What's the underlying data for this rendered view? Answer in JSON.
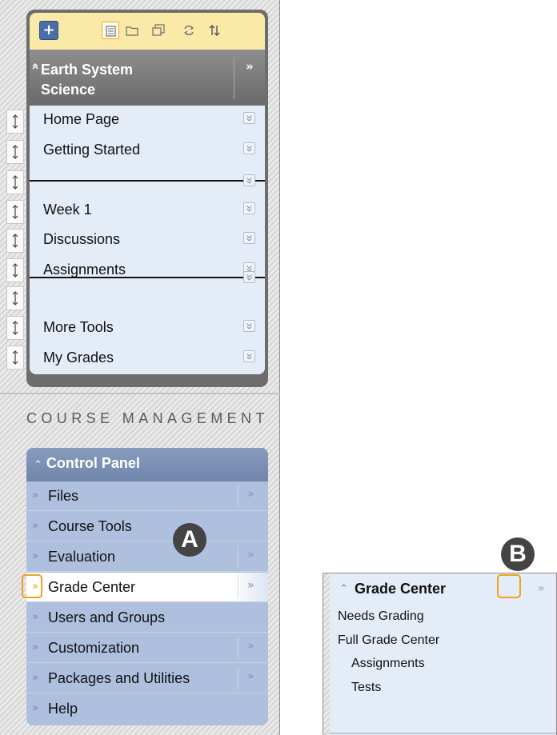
{
  "course_menu": {
    "title": "Earth System Science",
    "title_line1": "Earth System",
    "title_line2": "Science",
    "title_collapse_icon": "double-chevron-up-icon",
    "title_expand_icon": "double-chevron-right-icon",
    "toolbar_icons": [
      "plus-icon",
      "list-view-icon",
      "folder-view-icon",
      "new-window-icon",
      "refresh-icon",
      "reorder-icon"
    ],
    "items": [
      {
        "label": "Home Page"
      },
      {
        "label": "Getting Started"
      },
      {
        "label": "Week 1"
      },
      {
        "label": "Discussions"
      },
      {
        "label": "Assignments"
      },
      {
        "label": "More Tools"
      },
      {
        "label": "My Grades"
      }
    ]
  },
  "course_management": {
    "title": "COURSE MANAGEMENT",
    "control_panel": {
      "label": "Control Panel",
      "items": [
        {
          "label": "Files"
        },
        {
          "label": "Course Tools"
        },
        {
          "label": "Evaluation"
        },
        {
          "label": "Grade Center"
        },
        {
          "label": "Users and Groups"
        },
        {
          "label": "Customization"
        },
        {
          "label": "Packages and Utilities"
        },
        {
          "label": "Help"
        }
      ]
    }
  },
  "callouts": {
    "a": "A",
    "b": "B",
    "highlight_color": "#f0a21c"
  },
  "grade_center_popup": {
    "title": "Grade Center",
    "links": [
      "Needs Grading",
      "Full Grade Center"
    ],
    "sublinks": [
      "Assignments",
      "Tests"
    ]
  },
  "colors": {
    "course_menu_header": "#7d7d7d",
    "course_menu_list": "#e4ecf8",
    "control_panel_header": "#7c90b4",
    "control_panel_list": "#aec0dd",
    "toolbar": "#fbe9a8"
  }
}
